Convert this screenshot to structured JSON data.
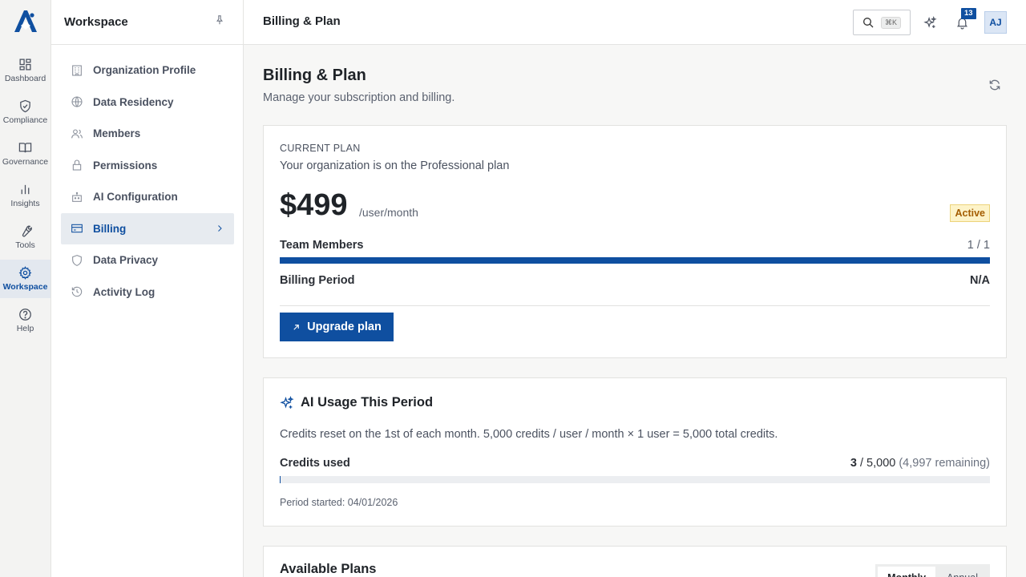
{
  "rail": {
    "items": [
      {
        "label": "Dashboard",
        "icon": "dashboard-icon"
      },
      {
        "label": "Compliance",
        "icon": "shield-check-icon"
      },
      {
        "label": "Governance",
        "icon": "book-icon"
      },
      {
        "label": "Insights",
        "icon": "bar-chart-icon"
      },
      {
        "label": "Tools",
        "icon": "wrench-icon"
      },
      {
        "label": "Workspace",
        "icon": "gear-icon",
        "active": true
      },
      {
        "label": "Help",
        "icon": "help-circle-icon"
      }
    ]
  },
  "sidebar": {
    "title": "Workspace",
    "items": [
      {
        "label": "Organization Profile",
        "icon": "building-icon"
      },
      {
        "label": "Data Residency",
        "icon": "globe-icon"
      },
      {
        "label": "Members",
        "icon": "users-icon"
      },
      {
        "label": "Permissions",
        "icon": "lock-icon"
      },
      {
        "label": "AI Configuration",
        "icon": "robot-icon"
      },
      {
        "label": "Billing",
        "icon": "credit-card-icon",
        "active": true
      },
      {
        "label": "Data Privacy",
        "icon": "shield-icon"
      },
      {
        "label": "Activity Log",
        "icon": "history-icon"
      }
    ]
  },
  "topbar": {
    "title": "Billing & Plan",
    "search_shortcut": "⌘K",
    "notification_count": "13",
    "avatar_initials": "AJ"
  },
  "page": {
    "title": "Billing & Plan",
    "subtitle": "Manage your subscription and billing."
  },
  "current_plan": {
    "eyebrow": "CURRENT PLAN",
    "description": "Your organization is on the Professional plan",
    "price": "$499",
    "price_unit": "/user/month",
    "status": "Active",
    "team_members_label": "Team Members",
    "team_members_value": "1 / 1",
    "team_members_fraction": 1.0,
    "billing_period_label": "Billing Period",
    "billing_period_value": "N/A",
    "upgrade_label": "Upgrade plan"
  },
  "ai_usage": {
    "title": "AI Usage This Period",
    "description": "Credits reset on the 1st of each month. 5,000 credits / user / month × 1 user = 5,000 total credits.",
    "credits_label": "Credits used",
    "credits_used": "3",
    "credits_total": " / 5,000",
    "credits_remaining": " (4,997 remaining)",
    "usage_fraction": 0.0006,
    "period_started": "Period started: 04/01/2026"
  },
  "plans": {
    "title": "Available Plans",
    "toggle": [
      "Monthly",
      "Annual"
    ]
  },
  "colors": {
    "accent": "#0f4fa0",
    "status_bg": "#fdf3c8",
    "status_text": "#a45d00"
  }
}
